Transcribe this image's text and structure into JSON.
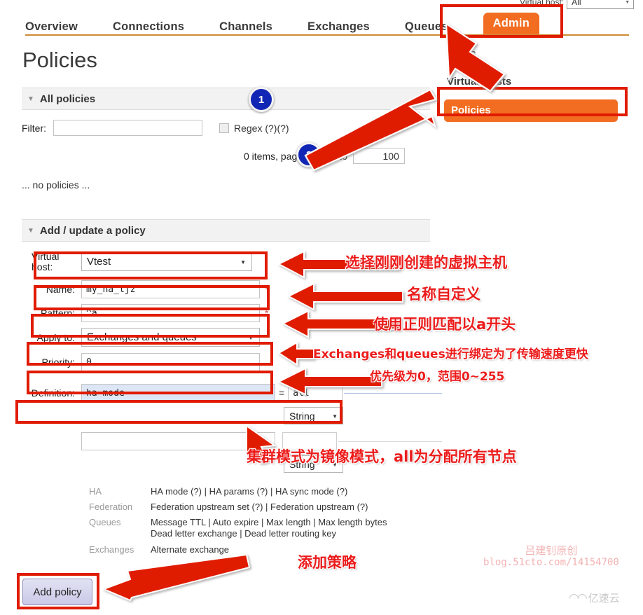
{
  "vhost_selector": {
    "label": "Virtual host:",
    "value": "All"
  },
  "topnav": {
    "tabs": [
      {
        "label": "Overview",
        "active": false
      },
      {
        "label": "Connections",
        "active": false
      },
      {
        "label": "Channels",
        "active": false
      },
      {
        "label": "Exchanges",
        "active": false
      },
      {
        "label": "Queues",
        "active": false
      },
      {
        "label": "Admin",
        "active": true
      }
    ]
  },
  "sidebar": {
    "items": [
      {
        "label": "Users",
        "active": false
      },
      {
        "label": "Virtual Hosts",
        "active": false
      },
      {
        "label": "Policies",
        "active": true
      }
    ]
  },
  "page": {
    "title": "Policies"
  },
  "all_policies": {
    "section_title": "All policies",
    "filter_label": "Filter:",
    "filter_value": "",
    "regex_label": "Regex (?)(?)",
    "regex_checked": false,
    "paging_text": "0 items, page size up to",
    "page_size": "100",
    "empty_text": "... no policies ..."
  },
  "add_policy": {
    "section_title": "Add / update a policy",
    "fields": {
      "vhost": {
        "label": "Virtual host:",
        "value": "Vtest"
      },
      "name": {
        "label": "Name:",
        "value": "my_ha_ljz",
        "required": "*"
      },
      "pattern": {
        "label": "Pattern:",
        "value": "^a",
        "required": "*"
      },
      "apply_to": {
        "label": "Apply to:",
        "value": "Exchanges and queues"
      },
      "priority": {
        "label": "Priority:",
        "value": "0"
      },
      "definition": {
        "label": "Definition:",
        "key": "ha-mode",
        "eq": "=",
        "value": "all",
        "type": "String"
      },
      "definition_empty": {
        "key": "",
        "value": "",
        "type": "String"
      }
    },
    "help": [
      {
        "category": "HA",
        "links": "HA mode (?) | HA params (?) | HA sync mode (?)"
      },
      {
        "category": "Federation",
        "links": "Federation upstream set (?) | Federation upstream (?)"
      },
      {
        "category": "Queues",
        "links": "Message TTL | Auto expire | Max length | Max length bytes\nDead letter exchange | Dead letter routing key"
      },
      {
        "category": "Exchanges",
        "links": "Alternate exchange"
      }
    ],
    "submit_label": "Add policy"
  },
  "annotations": {
    "badges": [
      {
        "label": "1"
      },
      {
        "label": "2"
      }
    ],
    "notes": [
      {
        "id": "note-vhost",
        "text": "选择刚刚创建的虚拟主机",
        "size": 21
      },
      {
        "id": "note-name",
        "text": "名称自定义",
        "size": 21
      },
      {
        "id": "note-pattern",
        "text": "使用正则匹配以a开头",
        "size": 21
      },
      {
        "id": "note-applyto",
        "text": "Exchanges和queues进行绑定为了传输速度更快",
        "size": 17
      },
      {
        "id": "note-priority",
        "text": "优先级为0，范围0~255",
        "size": 17
      },
      {
        "id": "note-definition",
        "text": "集群模式为镜像模式，all为分配所有节点",
        "size": 21
      },
      {
        "id": "note-addpolicy",
        "text": "添加策略",
        "size": 21
      }
    ],
    "highlight_color": "#e01b00",
    "badge_color": "#1226b5",
    "note_color": "#ec1c1c"
  },
  "watermark": {
    "line1": "吕建钊原创",
    "line2": "blog.51cto.com/14154700",
    "logo_text": "亿速云"
  }
}
